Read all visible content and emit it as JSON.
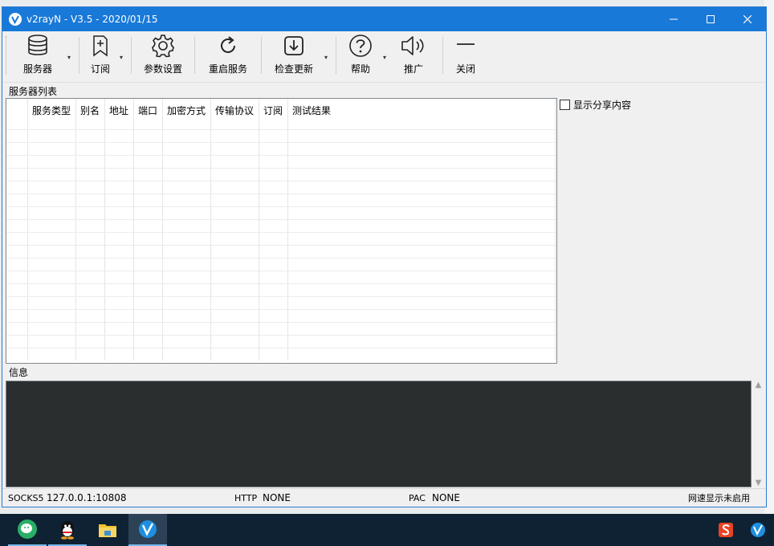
{
  "window": {
    "title": "v2rayN - V3.5 - 2020/01/15",
    "controls": [
      "minimize",
      "maximize",
      "close"
    ]
  },
  "toolbar": {
    "items": [
      {
        "label": "服务器",
        "icon": "database-icon",
        "dropdown": true
      },
      {
        "label": "订阅",
        "icon": "bookmark-add-icon",
        "dropdown": true
      },
      {
        "label": "参数设置",
        "icon": "gear-icon",
        "dropdown": false
      },
      {
        "label": "重启服务",
        "icon": "refresh-icon",
        "dropdown": false
      },
      {
        "label": "检查更新",
        "icon": "download-icon",
        "dropdown": true
      },
      {
        "label": "帮助",
        "icon": "help-icon",
        "dropdown": true
      },
      {
        "label": "推广",
        "icon": "speaker-icon",
        "dropdown": false
      },
      {
        "label": "关闭",
        "icon": "minus-icon",
        "dropdown": false
      }
    ]
  },
  "server_list": {
    "label": "服务器列表",
    "columns": [
      "",
      "服务类型",
      "别名",
      "地址",
      "端口",
      "加密方式",
      "传输协议",
      "订阅",
      "测试结果"
    ]
  },
  "side_panel": {
    "show_share_label": "显示分享内容",
    "show_share_checked": false
  },
  "info": {
    "label": "信息"
  },
  "statusbar": {
    "socks5_label": "SOCKS5",
    "socks5_value": "127.0.0.1:10808",
    "http_label": "HTTP",
    "http_value": "NONE",
    "pac_label": "PAC",
    "pac_value": "NONE",
    "speed_status": "网速显示未启用"
  },
  "colors": {
    "titlebar": "#1979d8",
    "info_bg": "#2b2e2f",
    "taskbar": "#0f2233"
  },
  "taskbar": {
    "apps": [
      "wechat-icon",
      "qq-icon",
      "file-explorer-icon",
      "v2rayn-icon"
    ],
    "tray": [
      "sogou-input-icon",
      "v2rayn-tray-icon"
    ]
  }
}
